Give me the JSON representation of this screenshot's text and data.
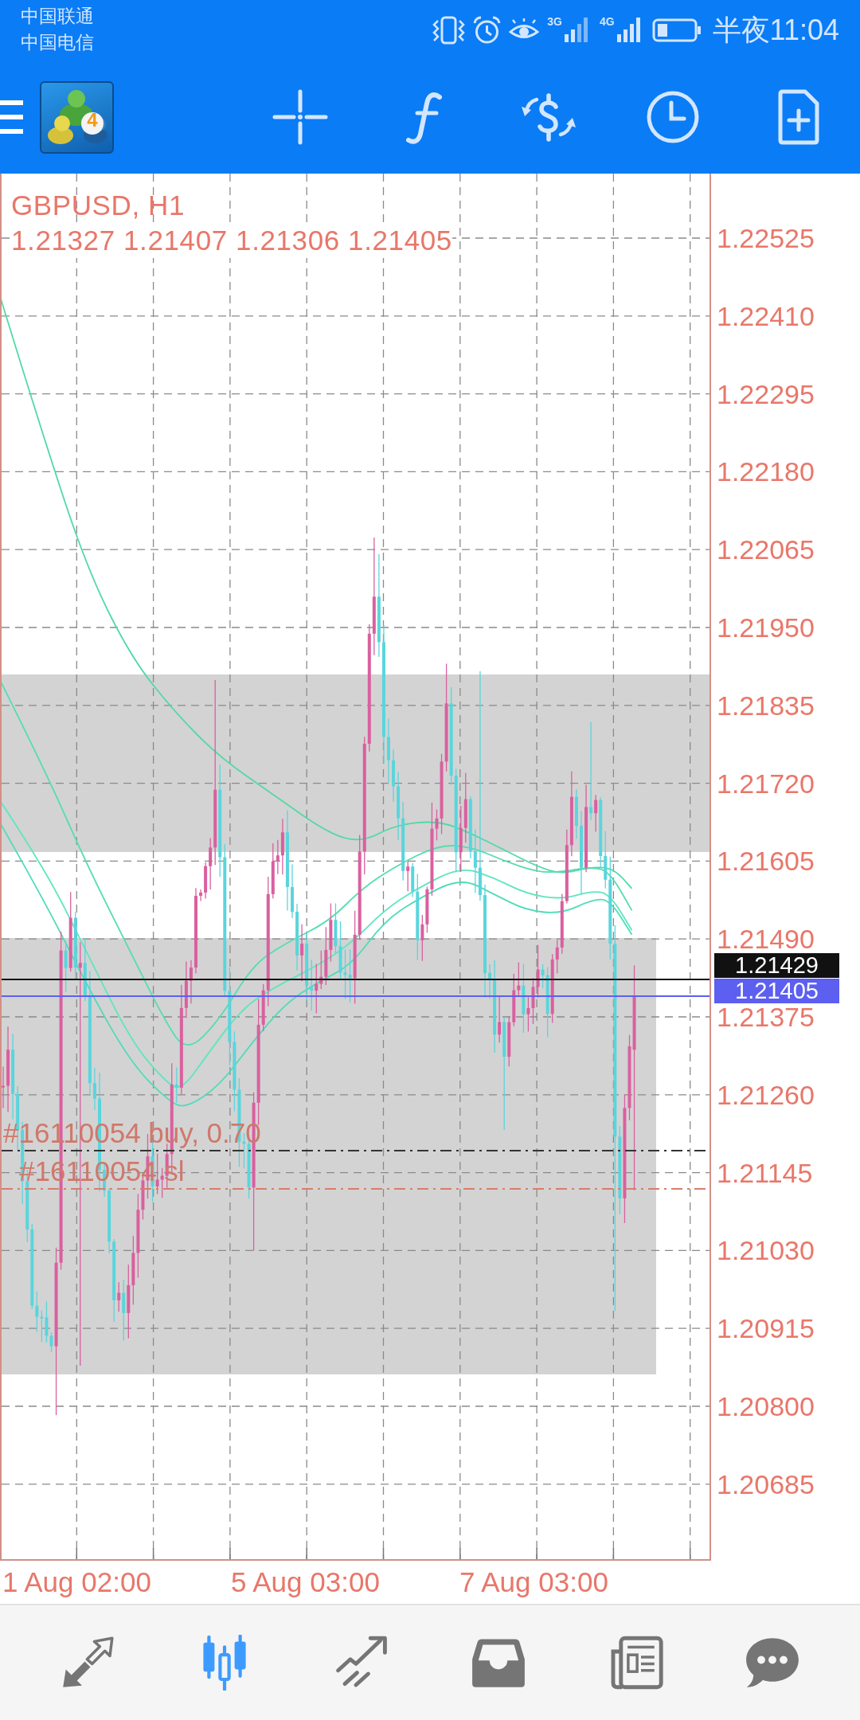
{
  "status_bar": {
    "carriers": [
      "中国联通",
      "中国电信"
    ],
    "networks": [
      "3G",
      "4G"
    ],
    "time": "半夜11:04"
  },
  "toolbar": {
    "logo_badge": "4"
  },
  "chart": {
    "symbol": "GBPUSD, H1",
    "ohlc": "1.21327 1.21407 1.21306 1.21405",
    "price_axis": [
      "1.22525",
      "1.22410",
      "1.22295",
      "1.22180",
      "1.22065",
      "1.21950",
      "1.21835",
      "1.21720",
      "1.21605",
      "1.21490",
      "1.21375",
      "1.21260",
      "1.21145",
      "1.21030",
      "1.20915",
      "1.20800",
      "1.20685"
    ],
    "price_tags": [
      {
        "price": "1.21429",
        "color": "#111111"
      },
      {
        "price": "1.21405",
        "color": "#5c5ff0"
      }
    ],
    "orders": [
      {
        "kind": "entry",
        "label": "#16110054 buy, 0.70"
      },
      {
        "kind": "stop_loss",
        "label": "#16110054 sl"
      }
    ],
    "time_axis": [
      "1 Aug 02:00",
      "5 Aug 03:00",
      "7 Aug 03:00"
    ]
  },
  "bottom_nav": [
    {
      "selected": false
    },
    {
      "selected": true
    },
    {
      "selected": false
    },
    {
      "selected": false
    },
    {
      "selected": false
    },
    {
      "selected": false
    }
  ]
}
